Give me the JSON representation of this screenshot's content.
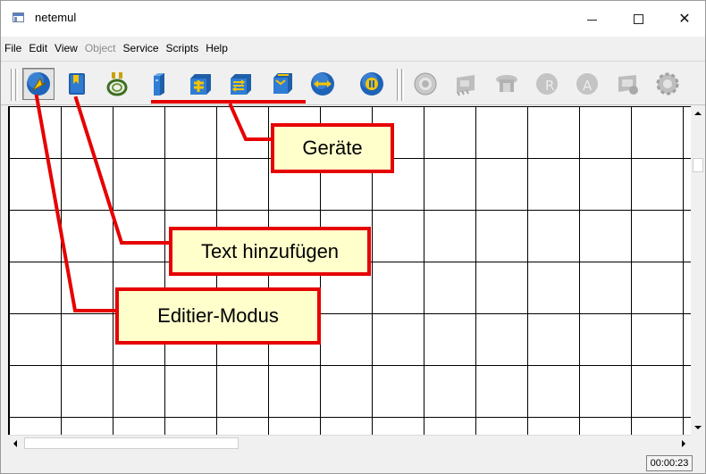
{
  "window": {
    "title": "netemul",
    "minimize_label": "",
    "maximize_label": "",
    "close_label": "✕"
  },
  "menu": [
    {
      "label": "File",
      "enabled": true
    },
    {
      "label": "Edit",
      "enabled": true
    },
    {
      "label": "View",
      "enabled": true
    },
    {
      "label": "Object",
      "enabled": false
    },
    {
      "label": "Service",
      "enabled": true
    },
    {
      "label": "Scripts",
      "enabled": true
    },
    {
      "label": "Help",
      "enabled": true
    }
  ],
  "toolbar": {
    "tools": [
      {
        "icon": "edit-mode-arrow-icon",
        "active": true
      },
      {
        "icon": "add-text-note-icon",
        "active": false
      },
      {
        "icon": "cable-connect-icon",
        "active": false
      },
      {
        "icon": "computer-device-icon",
        "active": false
      },
      {
        "icon": "hub-device-icon",
        "active": false
      },
      {
        "icon": "switch-device-icon",
        "active": false
      },
      {
        "icon": "router-device-icon",
        "active": false
      },
      {
        "icon": "move-arrows-icon",
        "active": false
      },
      {
        "icon": "pause-icon",
        "active": false
      }
    ],
    "disabled_tools": [
      {
        "icon": "settings-disc-icon"
      },
      {
        "icon": "network-card-icon"
      },
      {
        "icon": "table-icon"
      },
      {
        "icon": "routing-table-icon"
      },
      {
        "icon": "arp-table-icon"
      },
      {
        "icon": "program-icon"
      },
      {
        "icon": "gear-icon"
      }
    ]
  },
  "status": {
    "timer": "00:00:23"
  },
  "annotations": {
    "devices": "Geräte",
    "add_text": "Text hinzufügen",
    "edit_mode": "Editier-Modus",
    "color": "#e60000",
    "box_fill": "#ffffcc"
  }
}
